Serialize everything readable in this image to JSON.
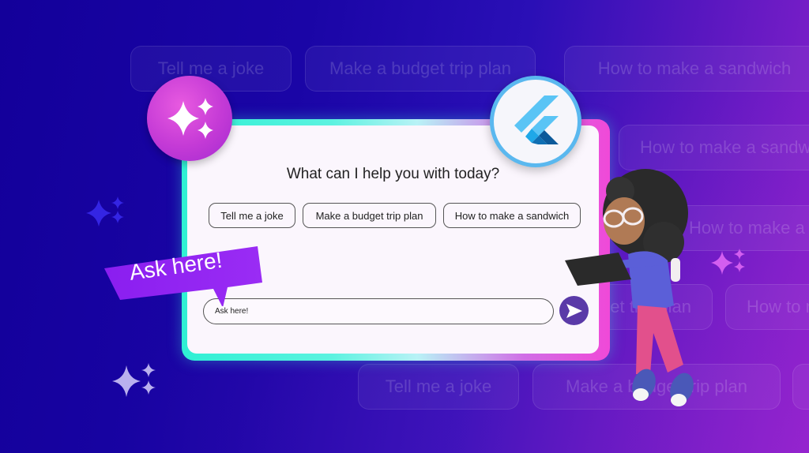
{
  "background_chips": [
    {
      "label": "Tell me a joke"
    },
    {
      "label": "Make a budget trip plan"
    },
    {
      "label": "How to make a sandwich"
    },
    {
      "label": "How to make a sandwich"
    },
    {
      "label": "How to make a sandwich"
    },
    {
      "label": "Make a budget trip plan"
    },
    {
      "label": "How to make a sandwich"
    },
    {
      "label": "Tell me a joke"
    },
    {
      "label": "Make a budget trip plan"
    }
  ],
  "card": {
    "title": "What can I help you with today?",
    "suggestions": [
      {
        "label": "Tell me a joke"
      },
      {
        "label": "Make a budget trip plan"
      },
      {
        "label": "How to make a sandwich"
      }
    ],
    "input": {
      "value": "Ask here!"
    },
    "send_icon": "send-icon"
  },
  "banner": {
    "label": "Ask here!"
  },
  "badges": {
    "magic": "sparkles-icon",
    "flutter": "flutter-logo-icon"
  },
  "colors": {
    "accent_send": "#5a3aa8",
    "banner": "#8a1ef0",
    "magic_circle": "#c43ad6",
    "flutter_ring": "#5ab8ef",
    "frame_start": "#2ff0d4",
    "frame_end": "#f049d8"
  }
}
